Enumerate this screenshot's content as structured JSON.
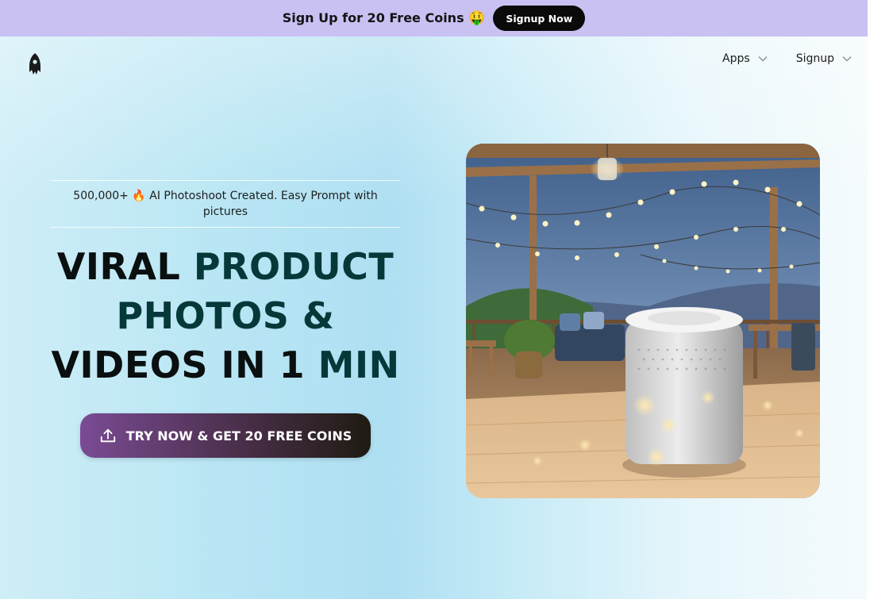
{
  "promo": {
    "text": "Sign Up for 20 Free Coins",
    "emoji": "🤑",
    "button_label": "Signup Now"
  },
  "nav": {
    "logo_icon": "rocket-logo-icon",
    "items": [
      {
        "label": "Apps",
        "icon": "chevron-down-icon"
      },
      {
        "label": "Signup",
        "icon": "chevron-down-icon"
      }
    ]
  },
  "hero": {
    "tagline": "500,000+ 🔥 AI Photoshoot Created. Easy Prompt with pictures",
    "headline": {
      "line1_a": "VIRAL ",
      "line1_b": "PRODUCT",
      "line2": "PHOTOS &",
      "line3_a": "VIDEOS IN 1 ",
      "line3_b": "MIN"
    },
    "cta_label": "TRY NOW & GET 20 FREE COINS",
    "cta_icon": "upload-icon"
  },
  "colors": {
    "banner": "#c8c1f2",
    "headline_dark": "#0a0f0f",
    "headline_teal": "#053838",
    "cta_start": "#7a4b94",
    "cta_end": "#1f1b12"
  }
}
